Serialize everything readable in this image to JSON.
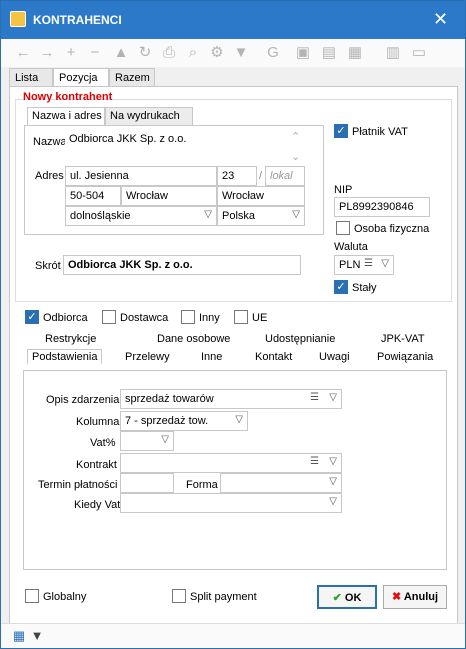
{
  "window": {
    "title": "KONTRAHENCI"
  },
  "tabs": [
    "Lista",
    "Pozycja",
    "Razem"
  ],
  "section": "Nowy kontrahent",
  "subtabs": [
    "Nazwa i adres",
    "Na wydrukach"
  ],
  "address": {
    "name_label": "Nazwa",
    "name_value": "Odbiorca JKK Sp. z o.o.",
    "address_label": "Adres",
    "street": "ul. Jesienna",
    "number": "23",
    "unit_placeholder": "lokal",
    "postcode": "50-504",
    "city": "Wrocław",
    "post_city": "Wrocław",
    "region": "dolnośląskie",
    "country": "Polska"
  },
  "vat": {
    "platnik_label": "Płatnik VAT",
    "platnik_checked": true
  },
  "nip": {
    "label": "NIP",
    "value": "PL8992390846"
  },
  "osoba_fizyczna": {
    "label": "Osoba fizyczna",
    "checked": false
  },
  "waluta": {
    "label": "Waluta",
    "value": "PLN"
  },
  "staly": {
    "label": "Stały",
    "checked": true
  },
  "skrot": {
    "label": "Skrót",
    "value": "Odbiorca JKK Sp. z o.o."
  },
  "roles": [
    {
      "label": "Odbiorca",
      "checked": true
    },
    {
      "label": "Dostawca",
      "checked": false
    },
    {
      "label": "Inny",
      "checked": false
    },
    {
      "label": "UE",
      "checked": false
    }
  ],
  "tabs2_row1": [
    "Restrykcje",
    "Dane osobowe",
    "Udostępnianie",
    "JPK-VAT"
  ],
  "tabs2_row2": [
    "Podstawienia",
    "Przelewy",
    "Inne",
    "Kontakt",
    "Uwagi",
    "Powiązania"
  ],
  "form": {
    "opis_label": "Opis zdarzenia",
    "opis_value": "sprzedaż towarów",
    "kolumna_label": "Kolumna",
    "kolumna_value": "7 - sprzedaż tow.",
    "vat_label": "Vat%",
    "kontrakt_label": "Kontrakt",
    "termin_label": "Termin płatności",
    "forma_label": "Forma",
    "kiedy_vat_label": "Kiedy Vat"
  },
  "bottom": {
    "globalny": "Globalny",
    "split": "Split payment",
    "ok": "OK",
    "cancel": "Anuluj"
  }
}
